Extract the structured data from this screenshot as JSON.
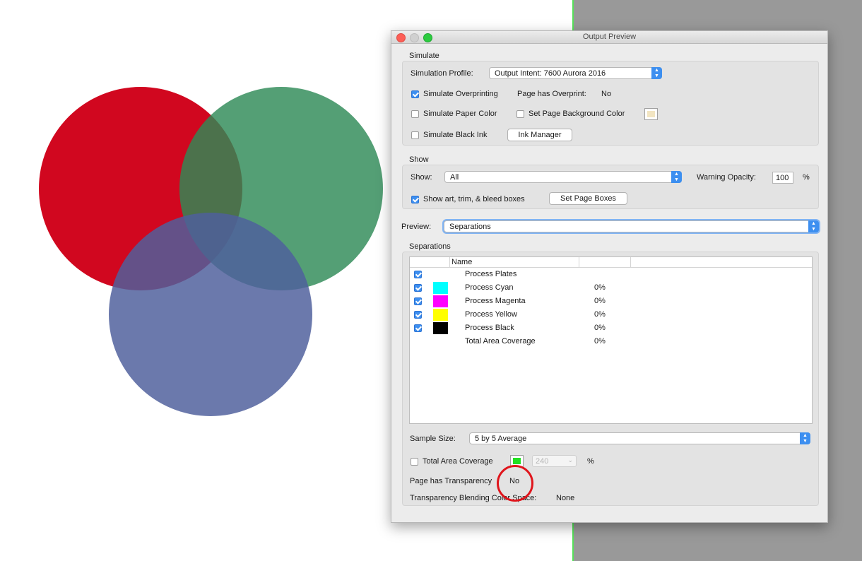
{
  "window": {
    "title": "Output Preview"
  },
  "simulate": {
    "section_label": "Simulate",
    "profile_label": "Simulation Profile:",
    "profile_value": "Output Intent: 7600 Aurora 2016",
    "overprinting_label": "Simulate Overprinting",
    "overprinting_checked": true,
    "page_has_overprint_label": "Page has Overprint:",
    "page_has_overprint_value": "No",
    "paper_color_label": "Simulate Paper Color",
    "bg_color_label": "Set Page Background Color",
    "bg_swatch_color": "#f2e5c2",
    "black_ink_label": "Simulate Black Ink",
    "ink_manager_label": "Ink Manager"
  },
  "show": {
    "section_label": "Show",
    "show_label": "Show:",
    "show_value": "All",
    "warning_opacity_label": "Warning Opacity:",
    "warning_opacity_value": "100",
    "percent": "%",
    "boxes_label": "Show art, trim, & bleed boxes",
    "boxes_checked": true,
    "set_page_boxes_label": "Set Page Boxes"
  },
  "preview": {
    "label": "Preview:",
    "value": "Separations"
  },
  "separations": {
    "section_label": "Separations",
    "column_name": "Name",
    "rows": [
      {
        "name": "Process Plates",
        "pct": "",
        "checked": true,
        "swatch": ""
      },
      {
        "name": "Process Cyan",
        "pct": "0%",
        "checked": true,
        "swatch": "#00ffff"
      },
      {
        "name": "Process Magenta",
        "pct": "0%",
        "checked": true,
        "swatch": "#ff00ff"
      },
      {
        "name": "Process Yellow",
        "pct": "0%",
        "checked": true,
        "swatch": "#ffff00"
      },
      {
        "name": "Process Black",
        "pct": "0%",
        "checked": true,
        "swatch": "#000000"
      },
      {
        "name": "Total Area Coverage",
        "pct": "0%",
        "checked": false,
        "swatch": ""
      }
    ]
  },
  "sample": {
    "label": "Sample Size:",
    "value": "5 by 5 Average"
  },
  "coverage": {
    "label": "Total Area Coverage",
    "swatch_color": "#22e022",
    "value": "240",
    "percent": "%"
  },
  "transparency": {
    "label": "Page has Transparency",
    "value": "No",
    "blending_label": "Transparency Blending Color Space:",
    "blending_value": "None"
  },
  "document": {
    "circle_colors": [
      "#d0021b",
      "#2e8a57",
      "#4f5f9c"
    ],
    "highlight_color": "#e0151c"
  }
}
